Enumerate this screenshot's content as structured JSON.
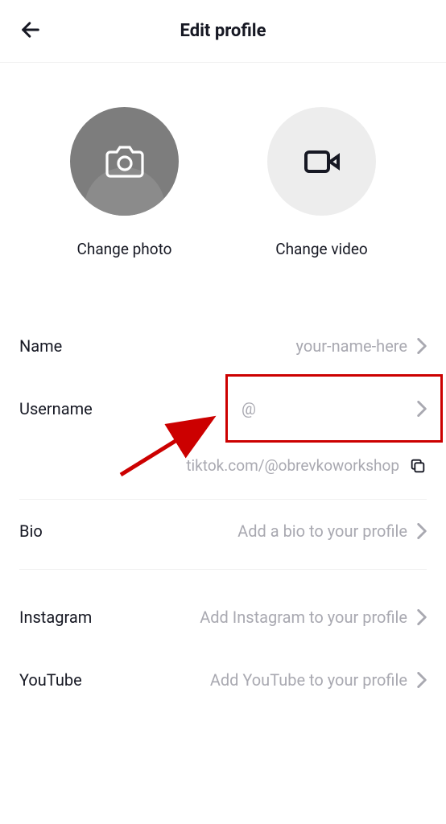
{
  "header": {
    "title": "Edit profile"
  },
  "media": {
    "photo_label": "Change photo",
    "video_label": "Change video"
  },
  "fields": {
    "name": {
      "label": "Name",
      "value": "your-name-here"
    },
    "username": {
      "label": "Username",
      "value": "@"
    },
    "url": "tiktok.com/@obrevkoworkshop",
    "bio": {
      "label": "Bio",
      "value": "Add a bio to your profile"
    },
    "instagram": {
      "label": "Instagram",
      "value": "Add Instagram to your profile"
    },
    "youtube": {
      "label": "YouTube",
      "value": "Add YouTube to your profile"
    }
  }
}
